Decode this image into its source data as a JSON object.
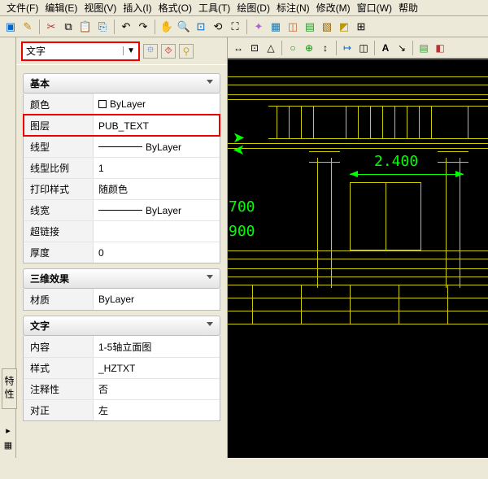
{
  "menu": {
    "file": "文件(F)",
    "edit": "编辑(E)",
    "view": "视图(V)",
    "insert": "插入(I)",
    "format": "格式(O)",
    "tools": "工具(T)",
    "draw": "绘图(D)",
    "annotate": "标注(N)",
    "modify": "修改(M)",
    "window": "窗口(W)",
    "help": "帮助"
  },
  "left_tab": "特性",
  "type_combo": "文字",
  "sections": {
    "basic": "基本",
    "threeD": "三维效果",
    "text": "文字"
  },
  "props": {
    "color": {
      "k": "颜色",
      "v": "ByLayer"
    },
    "layer": {
      "k": "图层",
      "v": "PUB_TEXT"
    },
    "linetype": {
      "k": "线型",
      "v": "ByLayer"
    },
    "ltscale": {
      "k": "线型比例",
      "v": "1"
    },
    "plotstyle": {
      "k": "打印样式",
      "v": "随颜色"
    },
    "lineweight": {
      "k": "线宽",
      "v": "ByLayer"
    },
    "hyperlink": {
      "k": "超链接",
      "v": ""
    },
    "thickness": {
      "k": "厚度",
      "v": "0"
    },
    "material": {
      "k": "材质",
      "v": "ByLayer"
    },
    "content": {
      "k": "内容",
      "v": "1-5轴立面图"
    },
    "style": {
      "k": "样式",
      "v": "_HZTXT"
    },
    "annotative": {
      "k": "注释性",
      "v": "否"
    },
    "justify": {
      "k": "对正",
      "v": "左"
    }
  },
  "dims": {
    "d1": "2.400",
    "d2": "700",
    "d3": "900"
  }
}
